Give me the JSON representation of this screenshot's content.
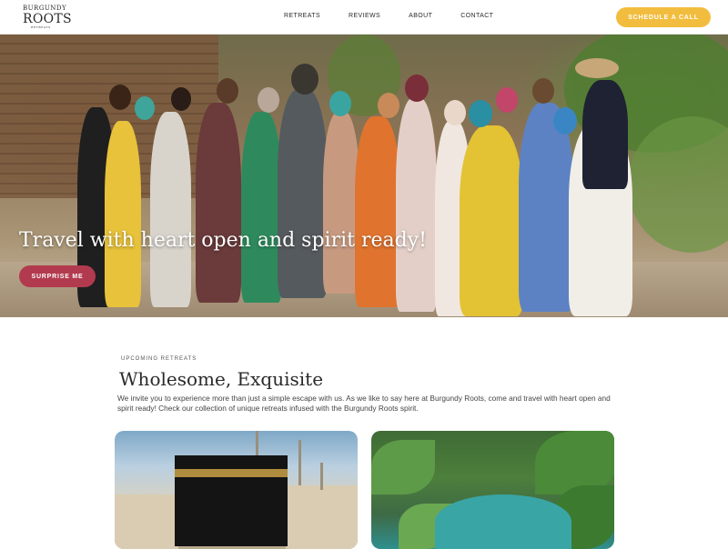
{
  "header": {
    "logo": {
      "line1": "BURGUNDY",
      "line2": "ROOTS",
      "line3": "RETREATS"
    },
    "nav": [
      "RETREATS",
      "REVIEWS",
      "ABOUT",
      "CONTACT"
    ],
    "cta_label": "SCHEDULE A CALL"
  },
  "hero": {
    "title": "Travel with heart open and spirit ready!",
    "button_label": "SURPRISE ME"
  },
  "section": {
    "eyebrow": "UPCOMING RETREATS",
    "title": "Wholesome, Exquisite",
    "description": "We invite you to experience more than just a simple escape with us. As we like to say here at Burgundy Roots, come and travel with heart open and spirit ready! Check our collection of unique retreats infused with the Burgundy Roots spirit."
  },
  "colors": {
    "accent_yellow": "#f2bd3e",
    "accent_burgundy": "#b23a4e"
  }
}
